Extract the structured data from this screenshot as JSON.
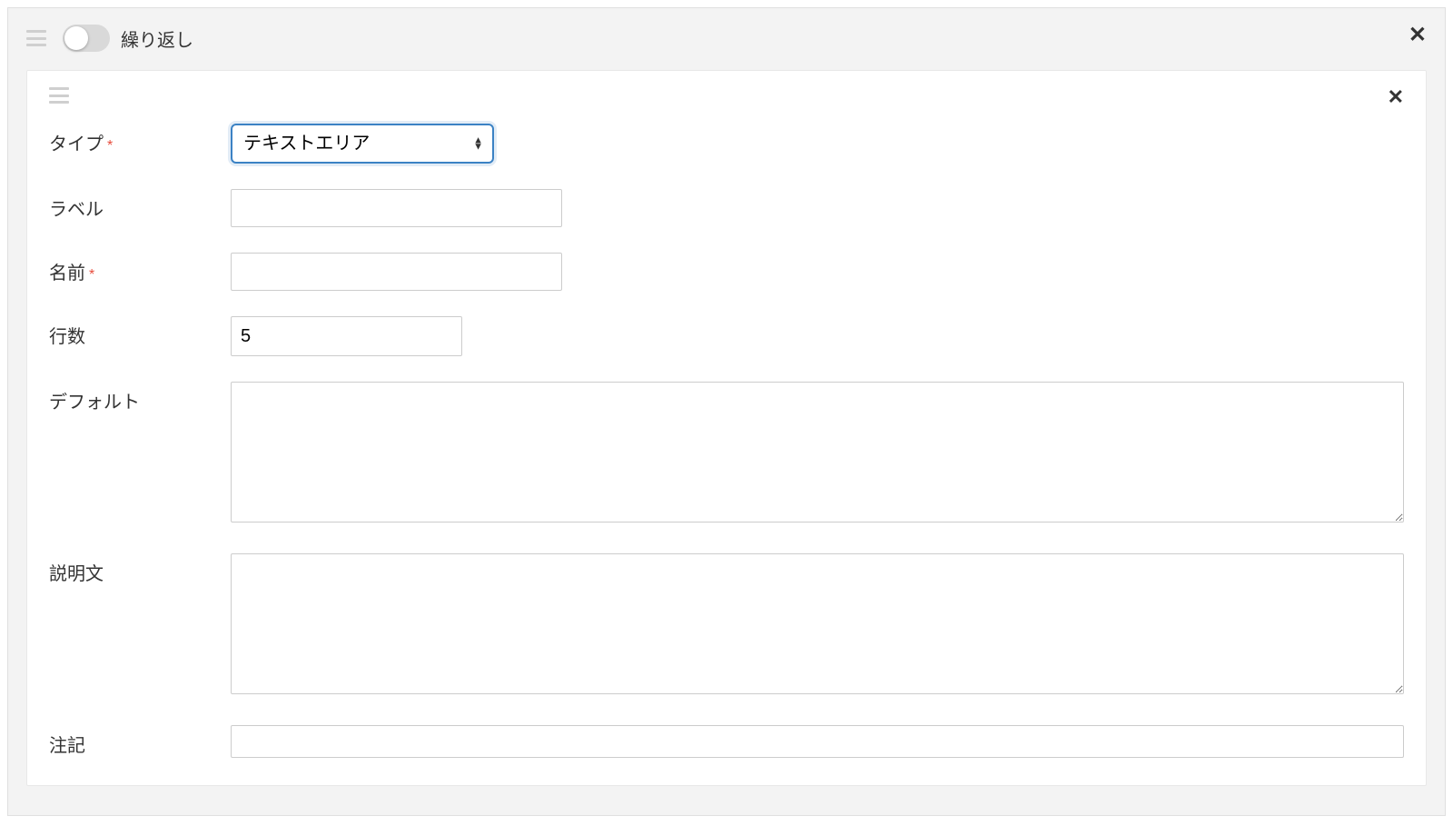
{
  "outer": {
    "toggle_label": "繰り返し",
    "toggle_on": false
  },
  "form": {
    "type": {
      "label": "タイプ",
      "required": "*",
      "value": "テキストエリア"
    },
    "label_field": {
      "label": "ラベル",
      "value": ""
    },
    "name": {
      "label": "名前",
      "required": "*",
      "value": ""
    },
    "rows": {
      "label": "行数",
      "value": "5"
    },
    "default": {
      "label": "デフォルト",
      "value": ""
    },
    "description": {
      "label": "説明文",
      "value": ""
    },
    "note": {
      "label": "注記",
      "value": ""
    }
  }
}
